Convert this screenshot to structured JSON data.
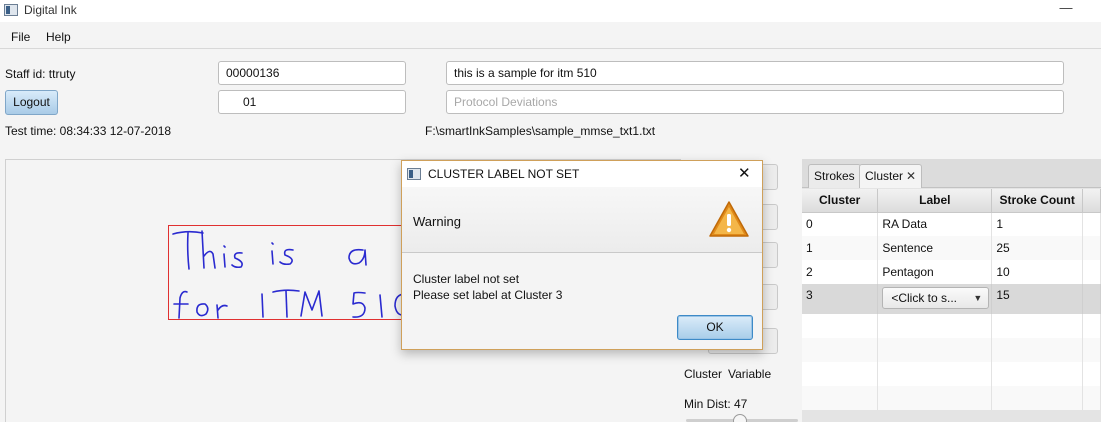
{
  "window": {
    "title": "Digital Ink",
    "minimize_glyph": "—"
  },
  "menu": {
    "items": [
      "File",
      "Help"
    ]
  },
  "form": {
    "staff_label": "Staff id: ttruty",
    "staff_number": "00000136",
    "session_number": "01",
    "sample_text": "this is a sample for itm 510",
    "protocol_placeholder": "Protocol Deviations",
    "logout_label": "Logout",
    "test_time": "Test time: 08:34:33 12-07-2018",
    "file_path": "F:\\smartInkSamples\\sample_mmse_txt1.txt"
  },
  "side_panel": {
    "cluster_label": "Cluster",
    "variable_label": "Variable",
    "min_dist_label": "Min Dist: 47"
  },
  "tabs": [
    {
      "label": "Strokes",
      "active": false
    },
    {
      "label": "Cluster",
      "active": true,
      "close_glyph": "✕"
    }
  ],
  "cluster_table": {
    "columns": [
      "Cluster",
      "Label",
      "Stroke Count"
    ],
    "rows": [
      {
        "cluster": "0",
        "label": "RA Data",
        "count": "1"
      },
      {
        "cluster": "1",
        "label": "Sentence",
        "count": "25"
      },
      {
        "cluster": "2",
        "label": "Pentagon",
        "count": "10"
      },
      {
        "cluster": "3",
        "label": "<Click to s...",
        "count": "15",
        "selected": true
      }
    ]
  },
  "dialog": {
    "title": "CLUSTER LABEL NOT SET",
    "close_glyph": "✕",
    "header": "Warning",
    "message_line1": "Cluster label not set",
    "message_line2": "Please set label at Cluster 3",
    "ok_label": "OK",
    "icon": "warning-icon"
  },
  "colors": {
    "ink": "#2a2ad0",
    "box_border": "#e03030",
    "warning": "#e08a1a",
    "dialog_border": "#cfa05a"
  }
}
